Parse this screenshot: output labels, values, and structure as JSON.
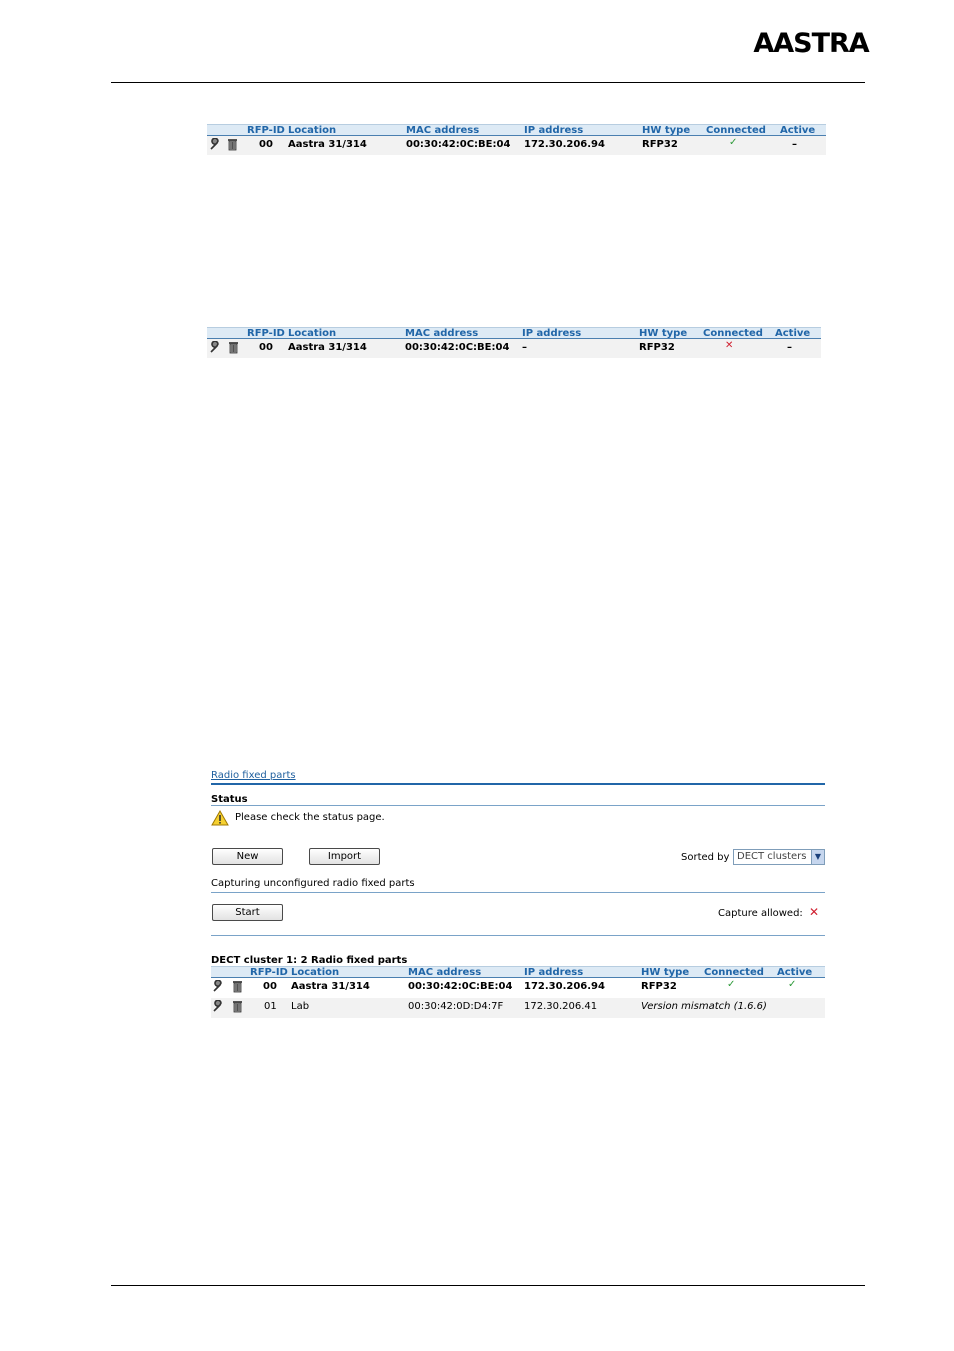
{
  "header": {
    "logo_text": "AASTRA"
  },
  "table1": {
    "headers": [
      "RFP-ID",
      "Location",
      "MAC address",
      "IP address",
      "HW type",
      "Connected",
      "Active"
    ],
    "row": {
      "id": "00",
      "location": "Aastra 31/314",
      "mac": "00:30:42:0C:BE:04",
      "ip": "172.30.206.94",
      "hw": "RFP32",
      "connected": "✓",
      "active": "–"
    }
  },
  "table2": {
    "headers": [
      "RFP-ID",
      "Location",
      "MAC address",
      "IP address",
      "HW type",
      "Connected",
      "Active"
    ],
    "row": {
      "id": "00",
      "location": "Aastra 31/314",
      "mac": "00:30:42:0C:BE:04",
      "ip": "–",
      "hw": "RFP32",
      "connected": "✕",
      "active": "–"
    }
  },
  "panel": {
    "title": "Radio fixed parts",
    "status_heading": "Status",
    "status_message": "Please check the status page.",
    "new_label": "New",
    "import_label": "Import",
    "sorted_by_label": "Sorted by",
    "sorted_by_value": "DECT clusters",
    "capturing_heading": "Capturing unconfigured radio fixed parts",
    "start_label": "Start",
    "capture_allowed_label": "Capture allowed:",
    "capture_allowed_value": "✕",
    "cluster_heading": "DECT cluster 1: 2 Radio fixed parts",
    "headers": [
      "RFP-ID",
      "Location",
      "MAC address",
      "IP address",
      "HW type",
      "Connected",
      "Active"
    ],
    "rows": [
      {
        "id": "00",
        "location": "Aastra 31/314",
        "mac": "00:30:42:0C:BE:04",
        "ip": "172.30.206.94",
        "hw": "RFP32",
        "connected": "✓",
        "active": "✓"
      },
      {
        "id": "01",
        "location": "Lab",
        "mac": "00:30:42:0D:D4:7F",
        "ip": "172.30.206.41",
        "hw": "Version mismatch (1.6.6)",
        "connected": "",
        "active": ""
      }
    ]
  },
  "colors": {
    "accent": "#2166a8",
    "ok": "#2e9a3a",
    "error": "#d02030",
    "warning": "#f0c020"
  }
}
